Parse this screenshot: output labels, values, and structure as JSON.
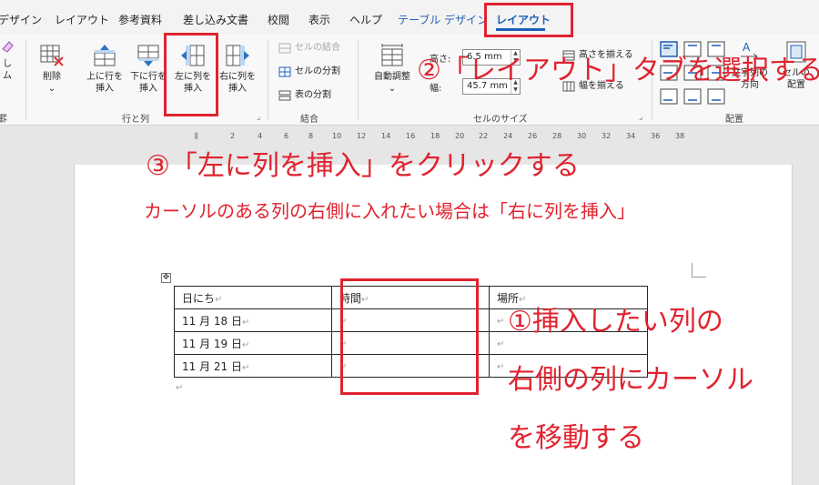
{
  "tabs": [
    "デザイン",
    "レイアウト",
    "参考資料",
    "差し込み文書",
    "校閲",
    "表示",
    "ヘルプ",
    "テーブル デザイン",
    "レイアウト"
  ],
  "ribbon": {
    "left_partial": {
      "label_top": "し",
      "label_bottom": "ム",
      "group": "罫"
    },
    "delete_label": "削除",
    "insert_above": [
      "上に行を",
      "挿入"
    ],
    "insert_below": [
      "下に行を",
      "挿入"
    ],
    "insert_left": [
      "左に列を",
      "挿入"
    ],
    "insert_right": [
      "右に列を",
      "挿入"
    ],
    "rows_cols_group": "行と列",
    "merge_cells": "セルの結合",
    "split_cells": "セルの分割",
    "split_table": "表の分割",
    "merge_group": "結合",
    "autofit": "自動調整",
    "height_label": "高さ:",
    "height_value": "6.5 mm",
    "width_label": "幅:",
    "width_value": "45.7 mm",
    "distribute_rows": "高さを揃える",
    "distribute_cols": "幅を揃える",
    "cell_size_group": "セルのサイズ",
    "text_direction": [
      "文字列の",
      "方向"
    ],
    "cell_margins": [
      "セルの",
      "配置"
    ],
    "alignment_group": "配置"
  },
  "ruler_ticks": [
    "2",
    "4",
    "6",
    "8",
    "10",
    "12",
    "14",
    "16",
    "18",
    "20",
    "22",
    "24",
    "26",
    "28",
    "30",
    "32",
    "34",
    "36",
    "38"
  ],
  "table": {
    "rows": [
      [
        "日にち",
        "時間",
        "場所"
      ],
      [
        "11 月 18 日",
        "",
        ""
      ],
      [
        "11 月 19 日",
        "",
        ""
      ],
      [
        "11 月 21 日",
        "",
        ""
      ]
    ],
    "cell_mark": "↵"
  },
  "annotations": {
    "step2": "②「レイアウト」タブを選択する",
    "step3": "③「左に列を挿入」をクリックする",
    "note": "カーソルのある列の右側に入れたい場合は「右に列を挿入」",
    "step1": [
      "①挿入したい列の",
      "右側の列にカーソル",
      "を移動する"
    ]
  },
  "colors": {
    "annotation_red": "#e0232f",
    "accent_blue": "#1e5fb4"
  }
}
